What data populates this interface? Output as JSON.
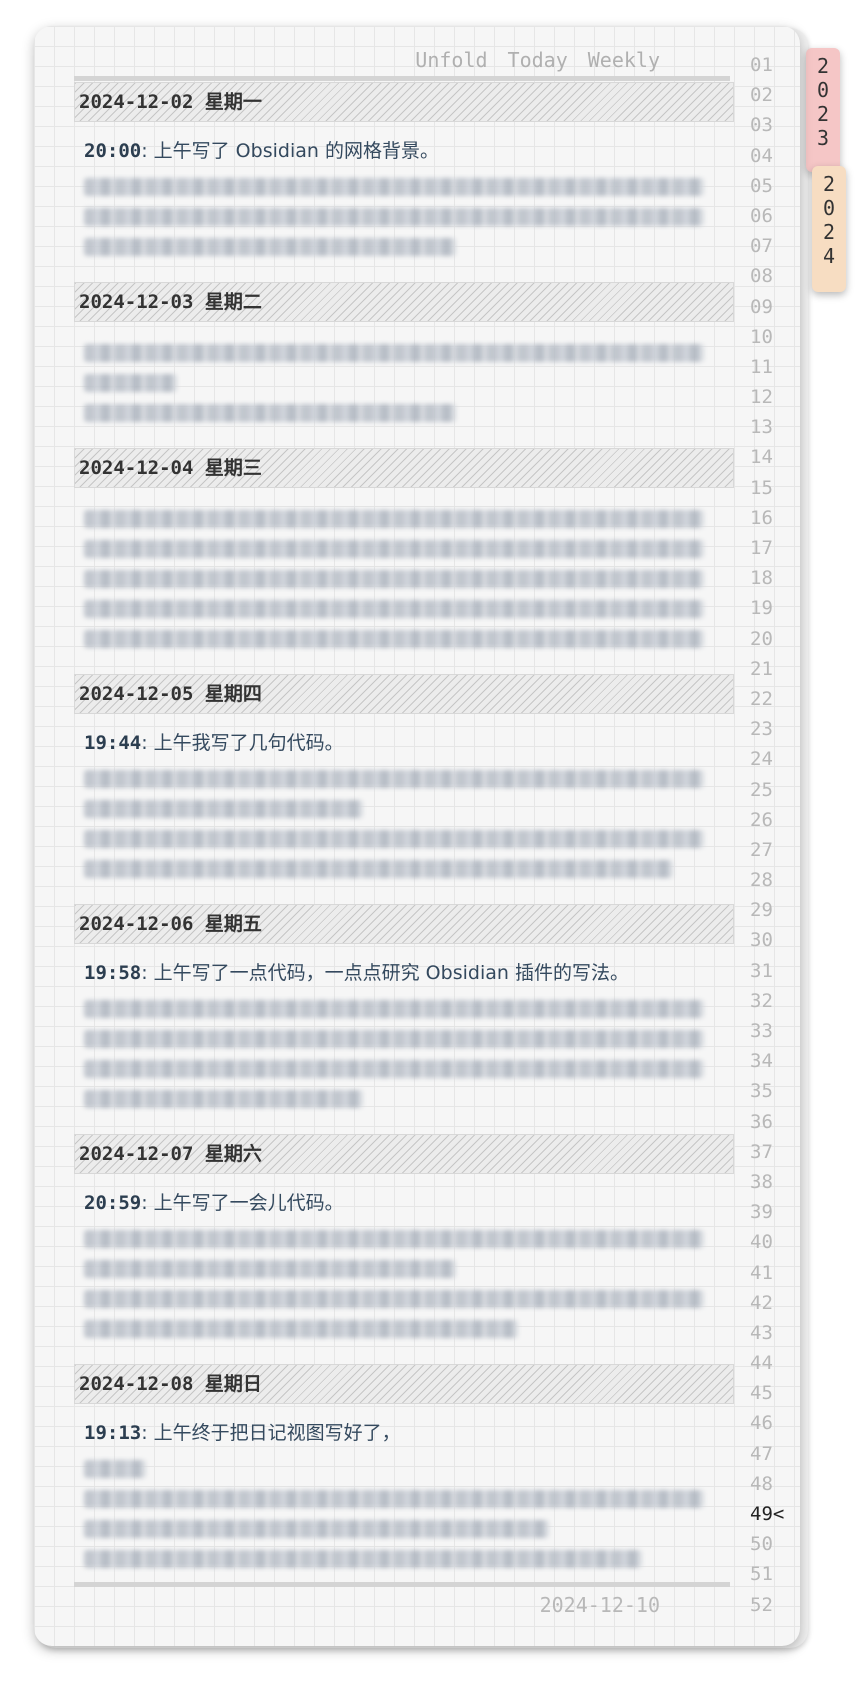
{
  "toolbar": {
    "unfold": "Unfold",
    "today": "Today",
    "weekly": "Weekly"
  },
  "footer": {
    "date": "2024-12-10"
  },
  "year_tabs": [
    {
      "label": "2\n0\n2\n3",
      "color": "#f5c6c6"
    },
    {
      "label": "2\n0\n2\n4",
      "color": "#f7ddc2"
    }
  ],
  "weeks": [
    "01",
    "02",
    "03",
    "04",
    "05",
    "06",
    "07",
    "08",
    "09",
    "10",
    "11",
    "12",
    "13",
    "14",
    "15",
    "16",
    "17",
    "18",
    "19",
    "20",
    "21",
    "22",
    "23",
    "24",
    "25",
    "26",
    "27",
    "28",
    "29",
    "30",
    "31",
    "32",
    "33",
    "34",
    "35",
    "36",
    "37",
    "38",
    "39",
    "40",
    "41",
    "42",
    "43",
    "44",
    "45",
    "46",
    "47",
    "48",
    "49",
    "50",
    "51",
    "52"
  ],
  "current_week": "49",
  "current_week_marker": "<",
  "entries": [
    {
      "date": "2024-12-02 星期一",
      "time": "20:00",
      "text": ": 上午写了 Obsidian 的网格背景。",
      "blur_lines": [
        1.0,
        1.0,
        0.6
      ]
    },
    {
      "date": "2024-12-03 星期二",
      "time": "",
      "text": "",
      "blur_lines": [
        1.0,
        0.15,
        0.6
      ]
    },
    {
      "date": "2024-12-04 星期三",
      "time": "",
      "text": "",
      "blur_lines": [
        1.0,
        1.0,
        1.0,
        1.0,
        1.0
      ]
    },
    {
      "date": "2024-12-05 星期四",
      "time": "19:44",
      "text": ": 上午我写了几句代码。",
      "blur_lines": [
        1.0,
        0.45,
        1.0,
        0.95
      ]
    },
    {
      "date": "2024-12-06 星期五",
      "time": "19:58",
      "text": ": 上午写了一点代码，一点点研究 Obsidian 插件的写法。",
      "blur_lines": [
        1.0,
        1.0,
        1.0,
        0.45
      ]
    },
    {
      "date": "2024-12-07 星期六",
      "time": "20:59",
      "text": ": 上午写了一会儿代码。",
      "blur_lines": [
        1.0,
        0.6,
        1.0,
        0.7
      ]
    },
    {
      "date": "2024-12-08 星期日",
      "time": "19:13",
      "text": ": 上午终于把日记视图写好了，",
      "blur_lines": [
        0.1,
        1.0,
        0.75,
        0.9
      ]
    }
  ]
}
